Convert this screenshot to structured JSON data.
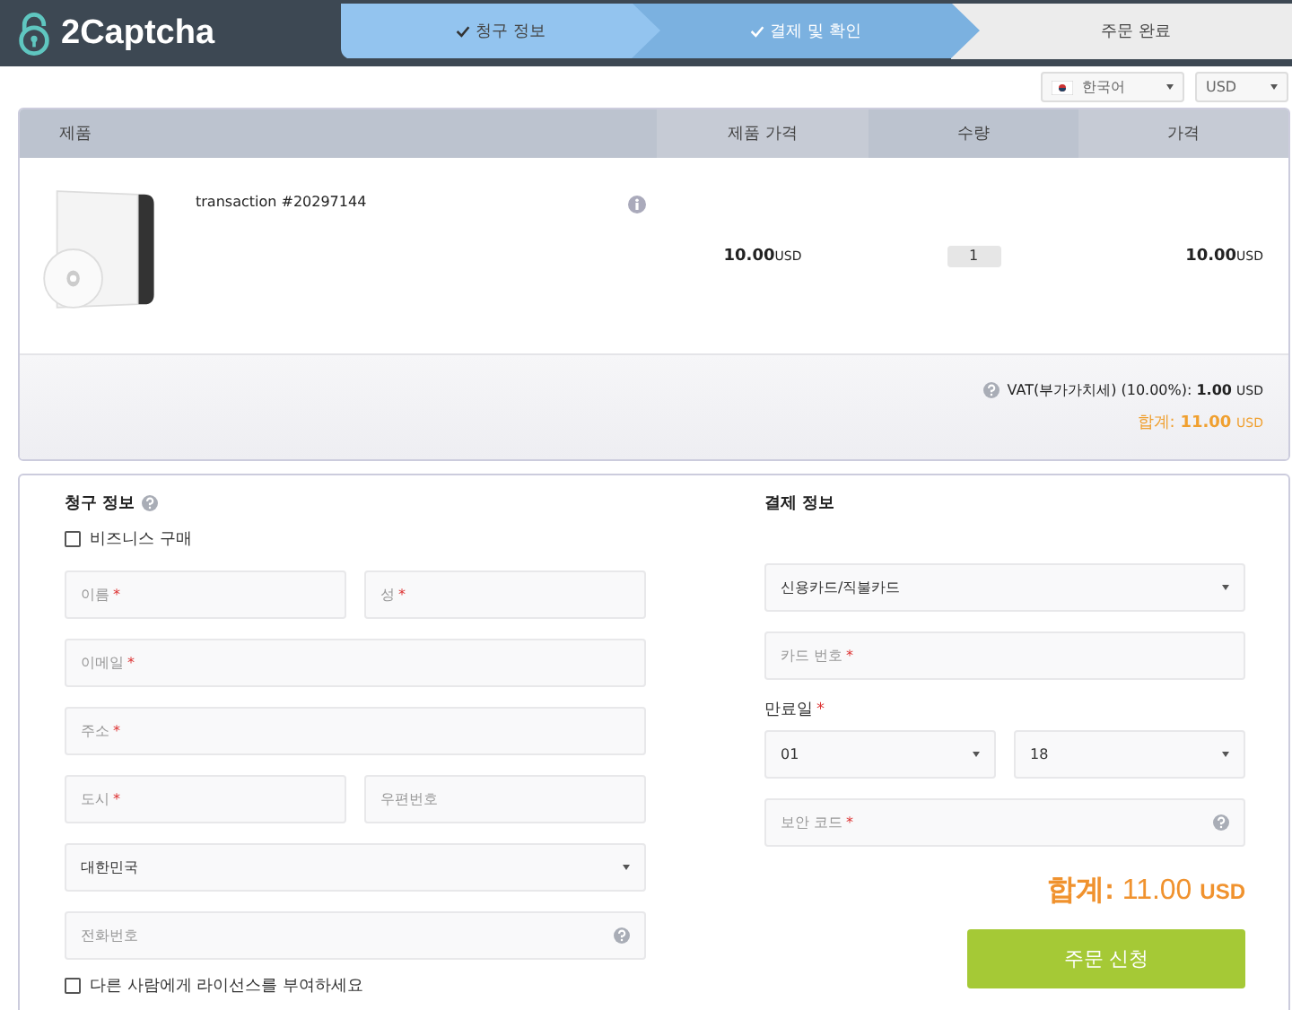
{
  "logo": {
    "text": "2Captcha"
  },
  "steps": [
    {
      "label": "청구 정보",
      "done": true,
      "selected": false
    },
    {
      "label": "결제 및 확인",
      "done": true,
      "selected": true
    },
    {
      "label": "주문 완료",
      "done": false,
      "selected": false
    }
  ],
  "language_select": {
    "value": "한국어"
  },
  "currency_select": {
    "value": "USD"
  },
  "cart": {
    "columns": [
      "제품",
      "제품 가격",
      "수량",
      "가격"
    ],
    "item": {
      "name": "transaction #20297144",
      "unit_price": "10.00",
      "unit_currency": "USD",
      "quantity": "1",
      "price": "10.00",
      "price_currency": "USD"
    },
    "vat": {
      "label": "VAT(부가가치세) (10.00%):",
      "amount": "1.00",
      "currency": "USD"
    },
    "total": {
      "label": "합계:",
      "amount": "11.00",
      "currency": "USD"
    }
  },
  "billing": {
    "title": "청구 정보",
    "business_checkbox": {
      "label": "비즈니스 구매",
      "checked": false
    },
    "rows": [
      [
        {
          "kind": "input",
          "placeholder": "이름",
          "required_mark": "*"
        },
        {
          "kind": "input",
          "placeholder": "성",
          "required_mark": "*"
        }
      ],
      [
        {
          "kind": "input",
          "placeholder": "이메일",
          "required_mark": "*"
        }
      ],
      [
        {
          "kind": "input",
          "placeholder": "주소",
          "required_mark": "*"
        }
      ],
      [
        {
          "kind": "input",
          "placeholder": "도시",
          "required_mark": "*"
        },
        {
          "kind": "input",
          "placeholder": "우편번호"
        }
      ],
      [
        {
          "kind": "select",
          "value": "대한민국"
        }
      ],
      [
        {
          "kind": "input",
          "placeholder": "전화번호",
          "help": true
        }
      ]
    ],
    "license_checkbox": {
      "label": "다른 사람에게 라이선스를 부여하세요",
      "checked": false
    }
  },
  "payment": {
    "title": "결제 정보",
    "method": {
      "value": "신용카드/직불카드"
    },
    "card_number": {
      "placeholder": "카드 번호",
      "required_mark": "*"
    },
    "expiry_label": {
      "text": "만료일",
      "required_mark": "*"
    },
    "month": {
      "value": "01"
    },
    "year": {
      "value": "18"
    },
    "security_code": {
      "placeholder": "보안 코드",
      "required_mark": "*",
      "help": true
    },
    "total": {
      "label": "합계:",
      "amount": "11.00",
      "currency": "USD"
    },
    "submit": "주문 신청"
  }
}
